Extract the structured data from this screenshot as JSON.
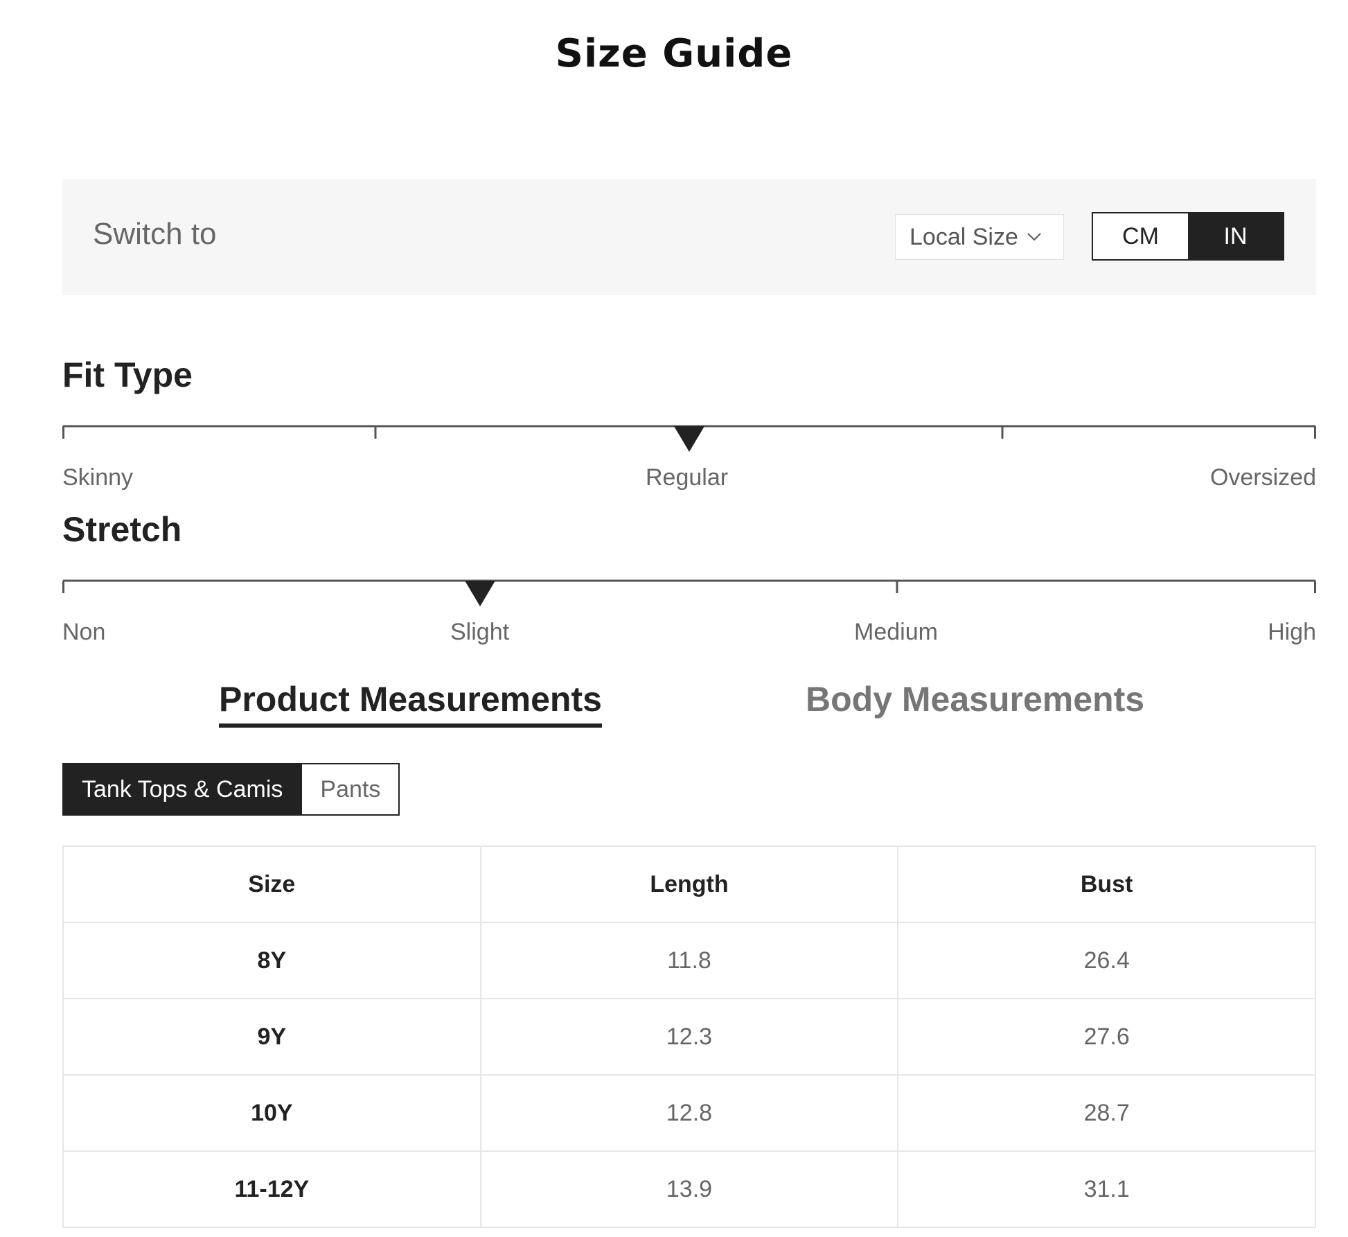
{
  "page": {
    "title": "Size Guide"
  },
  "switch_bar": {
    "label": "Switch to",
    "size_select": {
      "value": "Local Size",
      "icon": "chevron-down-icon"
    },
    "units": {
      "options": [
        "CM",
        "IN"
      ],
      "selected": "IN"
    }
  },
  "fit_type": {
    "title": "Fit Type",
    "labels": [
      "Skinny",
      "Regular",
      "Oversized"
    ],
    "levels": 5,
    "selected_level": 3,
    "selected_label": "Regular"
  },
  "stretch": {
    "title": "Stretch",
    "labels": [
      "Non",
      "Slight",
      "Medium",
      "High"
    ],
    "levels": 4,
    "selected_level": 2,
    "selected_label": "Slight"
  },
  "measurement_tabs": {
    "items": [
      "Product Measurements",
      "Body Measurements"
    ],
    "active": "Product Measurements"
  },
  "category_toggle": {
    "items": [
      "Tank Tops & Camis",
      "Pants"
    ],
    "active": "Tank Tops & Camis"
  },
  "size_table": {
    "headers": [
      "Size",
      "Length",
      "Bust"
    ],
    "rows": [
      [
        "8Y",
        "11.8",
        "26.4"
      ],
      [
        "9Y",
        "12.3",
        "27.6"
      ],
      [
        "10Y",
        "12.8",
        "28.7"
      ],
      [
        "11-12Y",
        "13.9",
        "31.1"
      ]
    ]
  },
  "colors": {
    "primary_dark": "#222222",
    "panel_bg": "#f6f6f6",
    "muted_text": "#666666",
    "border": "#e6e6e6"
  }
}
